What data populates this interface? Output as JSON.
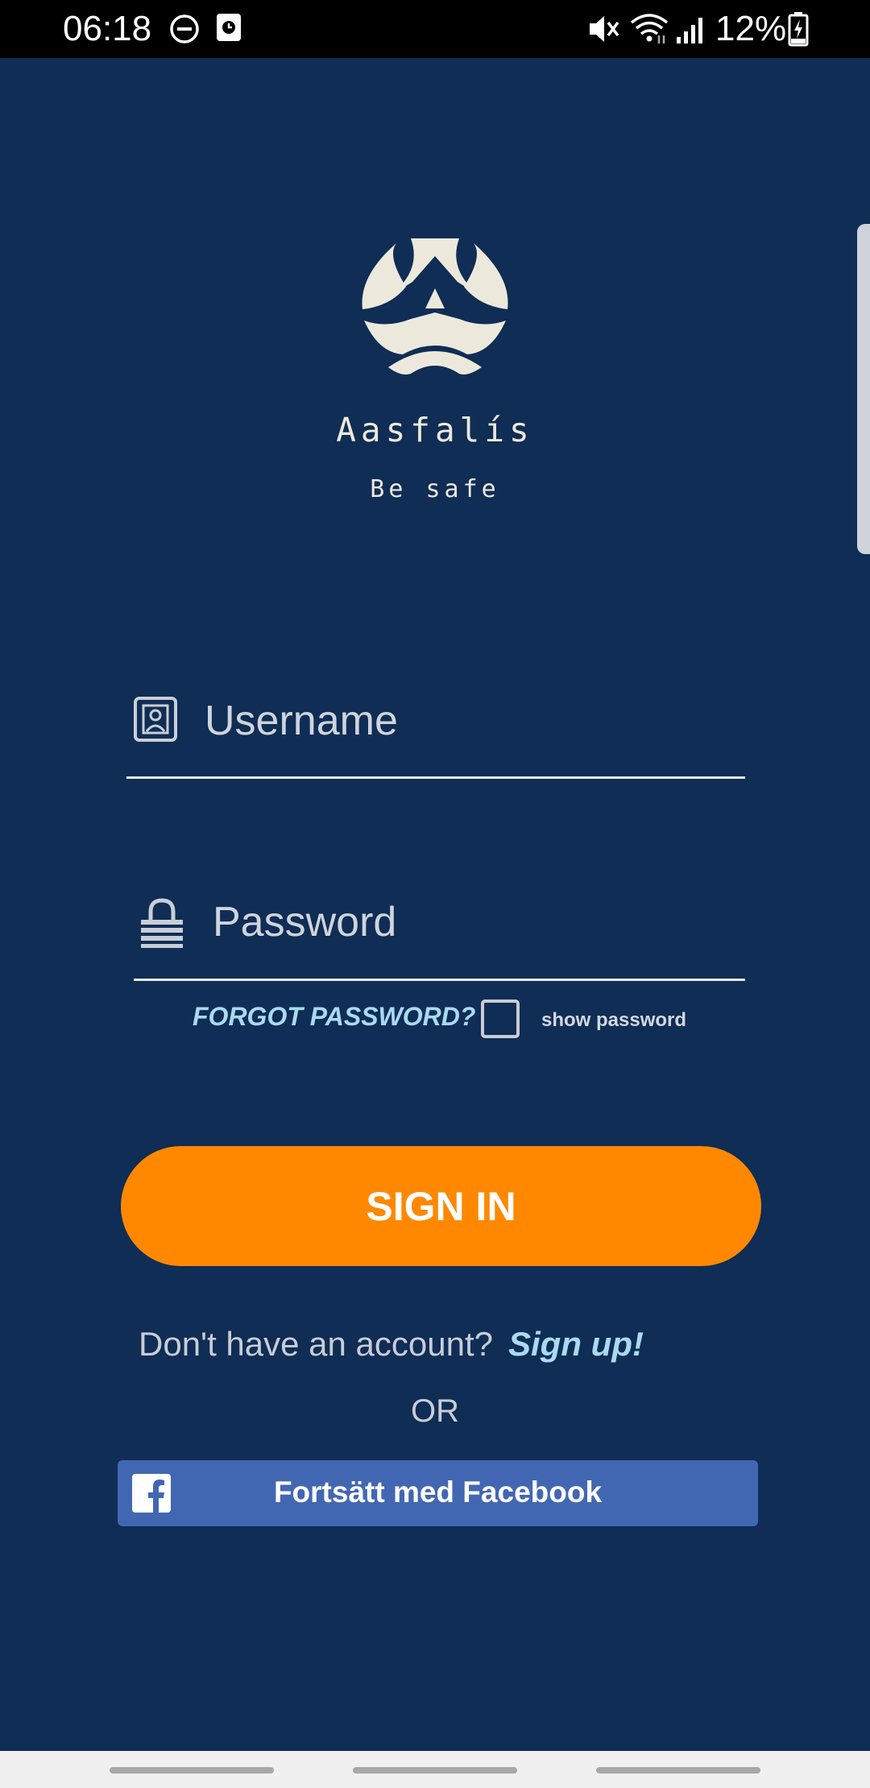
{
  "status_bar": {
    "time": "06:18",
    "battery": "12%",
    "icons": [
      "do-not-disturb-icon",
      "screen-record-icon",
      "mute-icon",
      "wifi-icon",
      "cell-signal-icon",
      "battery-charging-icon"
    ]
  },
  "brand": {
    "app_name": "Aasfalís",
    "tagline": "Be safe"
  },
  "form": {
    "username_placeholder": "Username",
    "username_value": "",
    "password_placeholder": "Password",
    "password_value": "",
    "forgot_password": "FORGOT PASSWORD?",
    "show_password_label": "show password",
    "show_password_checked": false,
    "sign_in": "SIGN IN"
  },
  "signup": {
    "prompt": "Don't have an account?",
    "link": "Sign up!",
    "or": "OR"
  },
  "facebook": {
    "label": "Fortsätt med Facebook"
  },
  "colors": {
    "background": "#0f2d55",
    "accent": "#ff8800",
    "link": "#a9daf0",
    "facebook": "#4267b2",
    "logo": "#ece9dc"
  }
}
